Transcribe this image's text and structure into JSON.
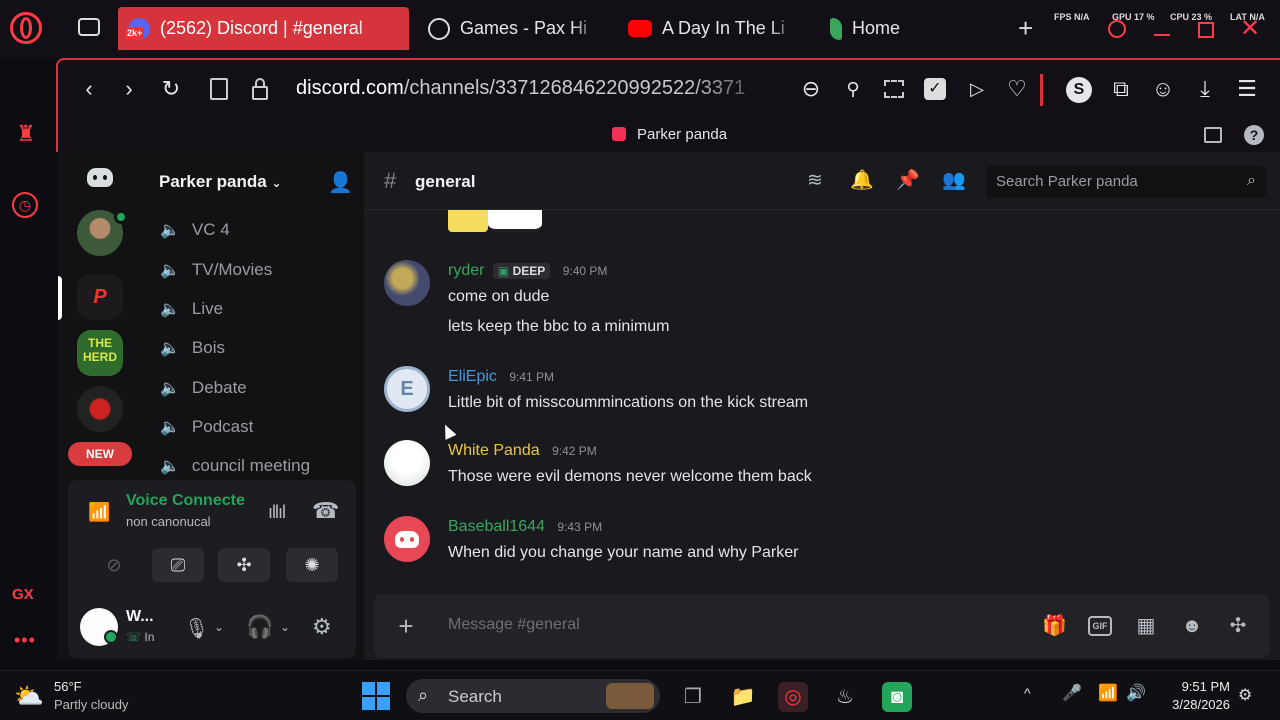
{
  "browser": {
    "tabs": [
      {
        "badge": "2k+",
        "label": "(2562) Discord | #general",
        "active": true
      },
      {
        "label": "Games - Pax Hi"
      },
      {
        "label": "A Day In The Li"
      },
      {
        "label": "Home"
      }
    ],
    "stats": {
      "fps": "FPS N/A",
      "gpu": "GPU 17 %",
      "cpu": "CPU 23 %",
      "lat": "LAT N/A"
    },
    "url_domain": "discord.com",
    "url_path": "/channels/337126846220992522/3371",
    "logo_text": "GX"
  },
  "discord": {
    "window_title": "Parker panda",
    "server_name": "Parker panda",
    "new_badge": "NEW",
    "channels": [
      "VC 4",
      "TV/Movies",
      "Live",
      "Bois",
      "Debate",
      "Podcast",
      "council meeting"
    ],
    "voice": {
      "status": "Voice Connecte",
      "channel": "non canonucal"
    },
    "user": {
      "name": "W...",
      "status": "In"
    },
    "channel_name": "general",
    "search_placeholder": "Search Parker panda",
    "messages": [
      {
        "author": "ryder",
        "tag": "DEEP",
        "time": "9:40 PM",
        "color": "#3ba55c",
        "lines": [
          "come on dude",
          "lets keep the bbc to a minimum"
        ]
      },
      {
        "author": "EliEpic",
        "time": "9:41 PM",
        "color": "#3f9ae0",
        "lines": [
          "Little bit of misscoummincations on the kick stream"
        ]
      },
      {
        "author": "White Panda",
        "time": "9:42 PM",
        "color": "#e8c547",
        "lines": [
          "Those were evil demons never welcome them back"
        ]
      },
      {
        "author": "Baseball1644",
        "time": "9:43 PM",
        "color": "#3ba55c",
        "lines": [
          "When did you change your name and why Parker"
        ]
      }
    ],
    "composer_placeholder": "Message #general"
  },
  "taskbar": {
    "weather_temp": "56°F",
    "weather_desc": "Partly cloudy",
    "search_label": "Search",
    "time": "9:51 PM",
    "date": "3/28/2026"
  },
  "colors": {
    "accent": "#d6343c",
    "blurple": "#5865f2"
  }
}
